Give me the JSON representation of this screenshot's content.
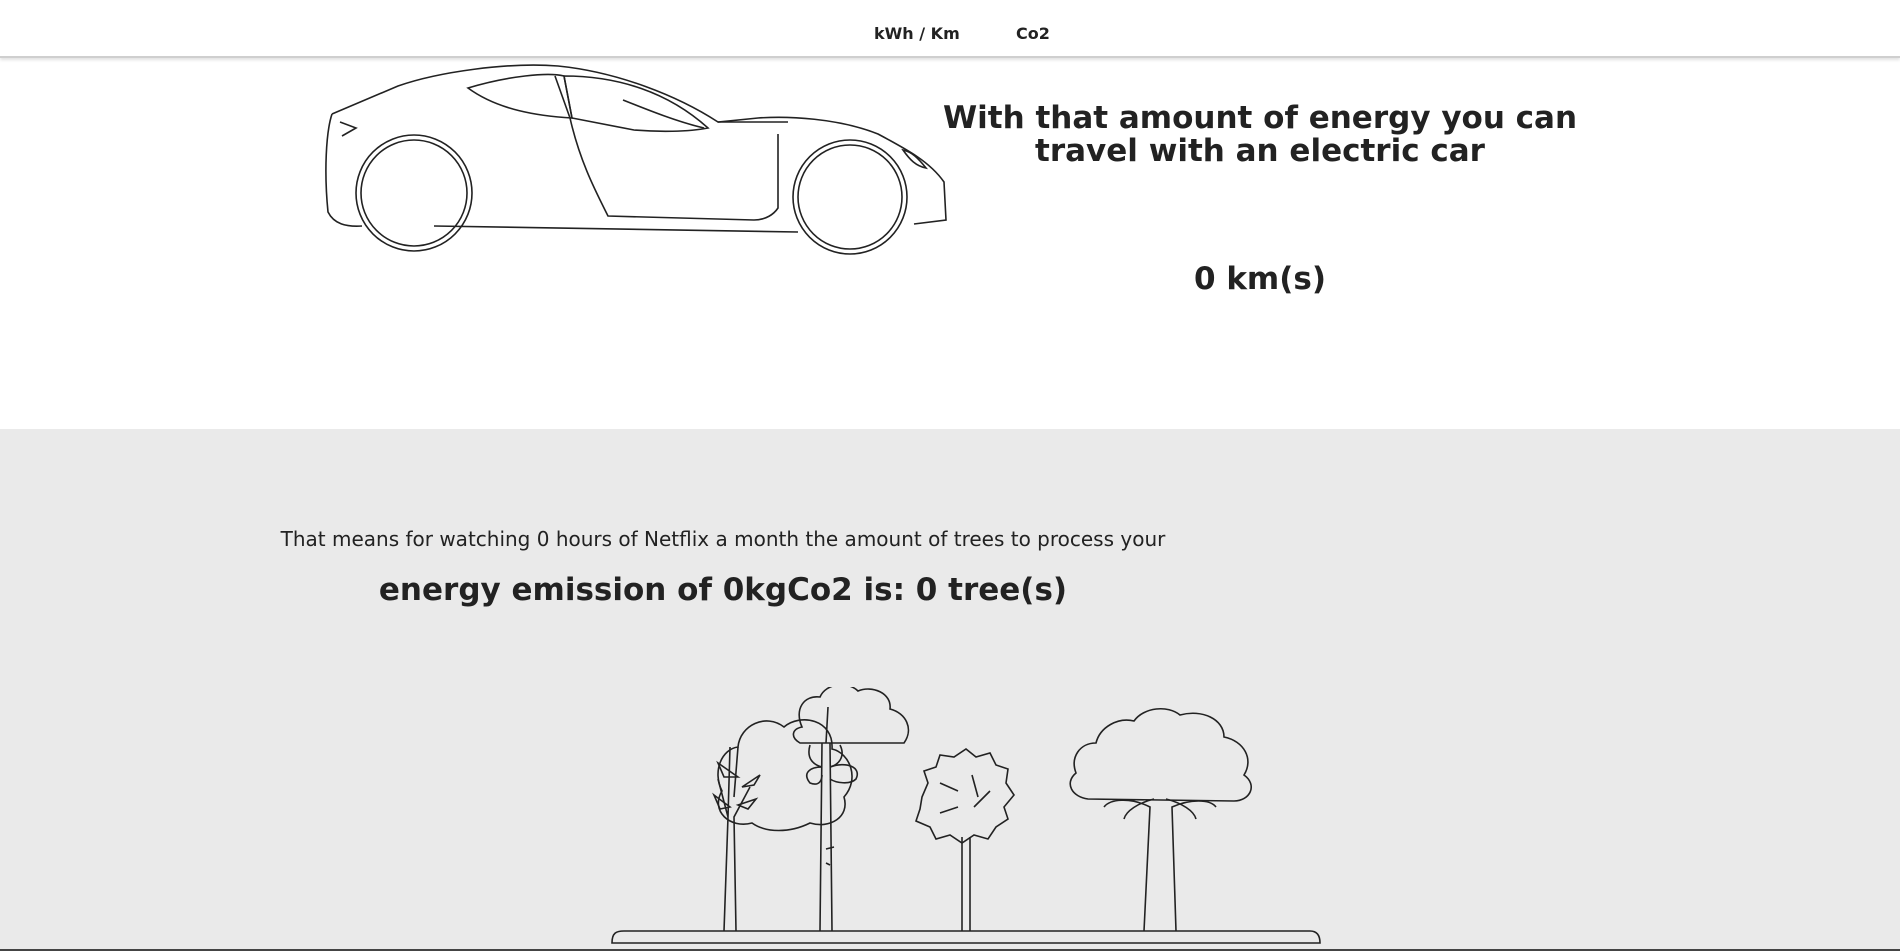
{
  "nav": {
    "items": [
      {
        "label": "kWh / Km"
      },
      {
        "label": "Co2"
      }
    ]
  },
  "car_section": {
    "heading": "With that amount of energy you can travel with an electric car",
    "distance": "0 km(s)",
    "illustration": "sports-car-outline"
  },
  "tree_section": {
    "netflix_text": "That means for watching 0 hours of Netflix a month the amount of trees to process your",
    "emission_text": "energy emission of 0kgCo2 is: 0 tree(s)",
    "illustration": "trees-outline"
  },
  "colors": {
    "page_bg": "#ffffff",
    "section_bg": "#eaeaea",
    "text": "#222222"
  }
}
